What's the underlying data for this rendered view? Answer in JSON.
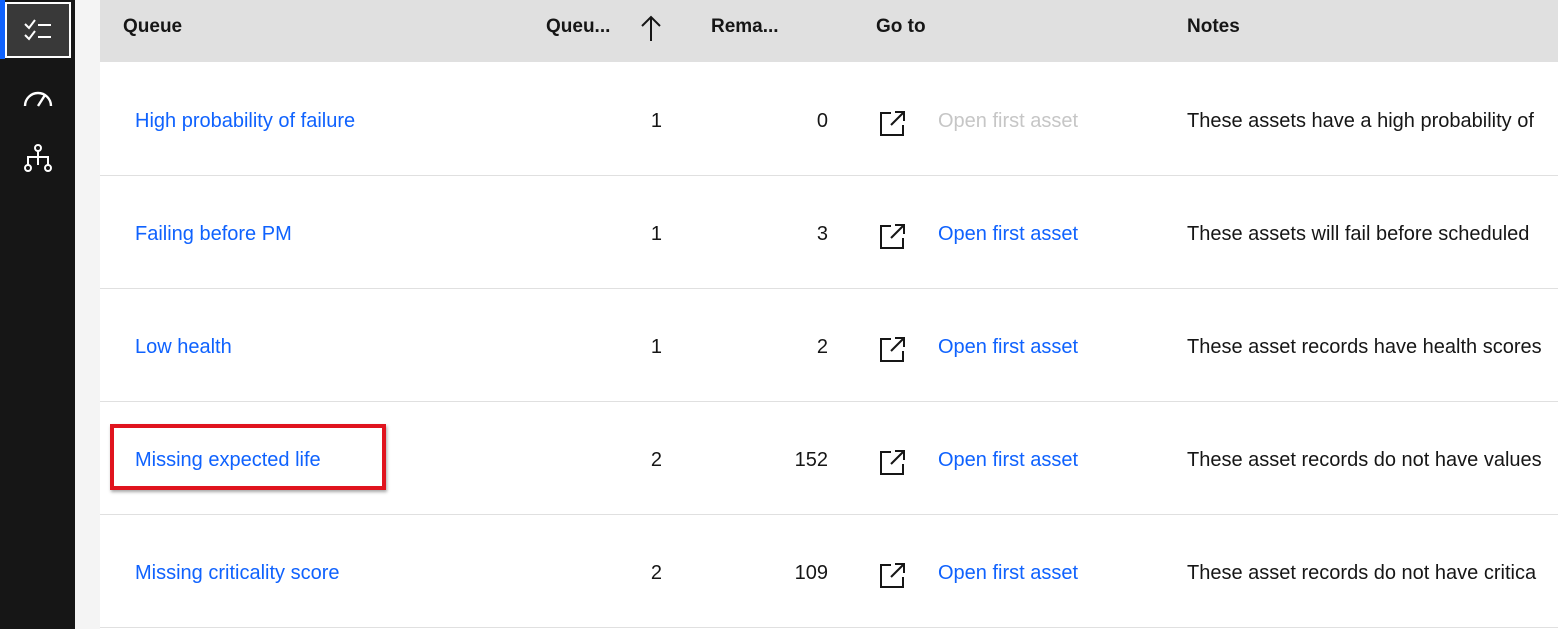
{
  "nav": {
    "items": [
      {
        "name": "checklist-icon",
        "active": true
      },
      {
        "name": "dashboard-gauge-icon",
        "active": false
      },
      {
        "name": "hierarchy-icon",
        "active": false
      }
    ]
  },
  "table": {
    "headers": {
      "queue": "Queue",
      "queue_priority": "Queu...",
      "remaining": "Rema...",
      "go_to": "Go to",
      "notes": "Notes"
    },
    "sort_icon": "arrow-up-icon",
    "launch_icon": "launch-icon",
    "rows": [
      {
        "queue": "High probability of failure",
        "priority": "1",
        "remaining": "0",
        "go_to": "Open first asset",
        "go_to_disabled": true,
        "notes": "These assets have a high probability of"
      },
      {
        "queue": "Failing before PM",
        "priority": "1",
        "remaining": "3",
        "go_to": "Open first asset",
        "go_to_disabled": false,
        "notes": "These assets will fail before scheduled"
      },
      {
        "queue": "Low health",
        "priority": "1",
        "remaining": "2",
        "go_to": "Open first asset",
        "go_to_disabled": false,
        "notes": "These asset records have health scores"
      },
      {
        "queue": "Missing expected life",
        "priority": "2",
        "remaining": "152",
        "go_to": "Open first asset",
        "go_to_disabled": false,
        "notes": "These asset records do not have values",
        "highlighted": true
      },
      {
        "queue": "Missing criticality score",
        "priority": "2",
        "remaining": "109",
        "go_to": "Open first asset",
        "go_to_disabled": false,
        "notes": "These asset records do not have critica"
      }
    ]
  },
  "colors": {
    "link": "#0f62fe",
    "rail": "#161616",
    "header_bg": "#e0e0e0",
    "highlight": "#e0141e",
    "disabled_text": "#c6c6c6"
  }
}
